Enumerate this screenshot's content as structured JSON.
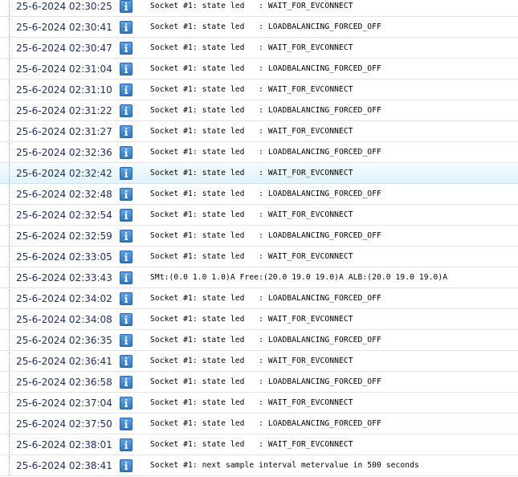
{
  "log": {
    "rows": [
      {
        "time": "25-6-2024 02:30:25",
        "type_icon": "info-icon",
        "message": "Socket #1: state led   : WAIT_FOR_EVCONNECT"
      },
      {
        "time": "25-6-2024 02:30:41",
        "type_icon": "info-icon",
        "message": "Socket #1: state led   : LOADBALANCING_FORCED_OFF"
      },
      {
        "time": "25-6-2024 02:30:47",
        "type_icon": "info-icon",
        "message": "Socket #1: state led   : WAIT_FOR_EVCONNECT"
      },
      {
        "time": "25-6-2024 02:31:04",
        "type_icon": "info-icon",
        "message": "Socket #1: state led   : LOADBALANCING_FORCED_OFF"
      },
      {
        "time": "25-6-2024 02:31:10",
        "type_icon": "info-icon",
        "message": "Socket #1: state led   : WAIT_FOR_EVCONNECT"
      },
      {
        "time": "25-6-2024 02:31:22",
        "type_icon": "info-icon",
        "message": "Socket #1: state led   : LOADBALANCING_FORCED_OFF"
      },
      {
        "time": "25-6-2024 02:31:27",
        "type_icon": "info-icon",
        "message": "Socket #1: state led   : WAIT_FOR_EVCONNECT"
      },
      {
        "time": "25-6-2024 02:32:36",
        "type_icon": "info-icon",
        "message": "Socket #1: state led   : LOADBALANCING_FORCED_OFF"
      },
      {
        "time": "25-6-2024 02:32:42",
        "type_icon": "info-icon",
        "message": "Socket #1: state led   : WAIT_FOR_EVCONNECT",
        "selected": true
      },
      {
        "time": "25-6-2024 02:32:48",
        "type_icon": "info-icon",
        "message": "Socket #1: state led   : LOADBALANCING_FORCED_OFF"
      },
      {
        "time": "25-6-2024 02:32:54",
        "type_icon": "info-icon",
        "message": "Socket #1: state led   : WAIT_FOR_EVCONNECT"
      },
      {
        "time": "25-6-2024 02:32:59",
        "type_icon": "info-icon",
        "message": "Socket #1: state led   : LOADBALANCING_FORCED_OFF"
      },
      {
        "time": "25-6-2024 02:33:05",
        "type_icon": "info-icon",
        "message": "Socket #1: state led   : WAIT_FOR_EVCONNECT"
      },
      {
        "time": "25-6-2024 02:33:43",
        "type_icon": "info-icon",
        "message": "SMt:(0.0 1.0 1.0)A Free:(20.0 19.0 19.0)A ALB:(20.0 19.0 19.0)A"
      },
      {
        "time": "25-6-2024 02:34:02",
        "type_icon": "info-icon",
        "message": "Socket #1: state led   : LOADBALANCING_FORCED_OFF"
      },
      {
        "time": "25-6-2024 02:34:08",
        "type_icon": "info-icon",
        "message": "Socket #1: state led   : WAIT_FOR_EVCONNECT"
      },
      {
        "time": "25-6-2024 02:36:35",
        "type_icon": "info-icon",
        "message": "Socket #1: state led   : LOADBALANCING_FORCED_OFF"
      },
      {
        "time": "25-6-2024 02:36:41",
        "type_icon": "info-icon",
        "message": "Socket #1: state led   : WAIT_FOR_EVCONNECT"
      },
      {
        "time": "25-6-2024 02:36:58",
        "type_icon": "info-icon",
        "message": "Socket #1: state led   : LOADBALANCING_FORCED_OFF"
      },
      {
        "time": "25-6-2024 02:37:04",
        "type_icon": "info-icon",
        "message": "Socket #1: state led   : WAIT_FOR_EVCONNECT"
      },
      {
        "time": "25-6-2024 02:37:50",
        "type_icon": "info-icon",
        "message": "Socket #1: state led   : LOADBALANCING_FORCED_OFF"
      },
      {
        "time": "25-6-2024 02:38:01",
        "type_icon": "info-icon",
        "message": "Socket #1: state led   : WAIT_FOR_EVCONNECT"
      },
      {
        "time": "25-6-2024 02:38:41",
        "type_icon": "info-icon",
        "message": "Socket #1: next sample interval metervalue in 500 seconds"
      }
    ]
  },
  "colors": {
    "timestamp_text": "#1e2f6b",
    "info_icon_bg": "#3a87d6",
    "selected_row_bg": "#e6f5fd",
    "row_divider": "#e3e3e3"
  }
}
